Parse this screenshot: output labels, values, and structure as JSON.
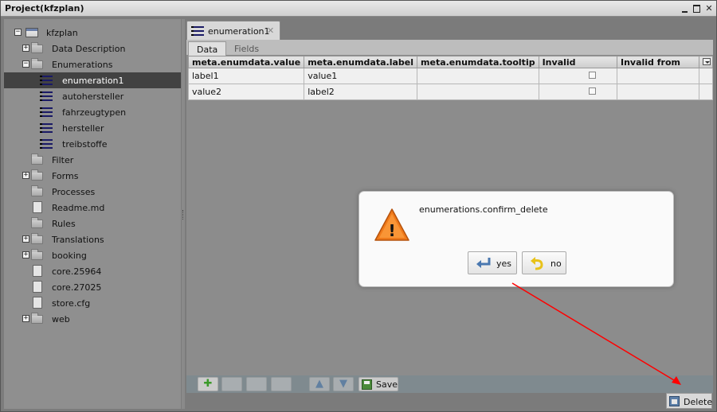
{
  "window": {
    "title": "Project(kfzplan)",
    "minimize_icon": "minimize-icon",
    "maximize_icon": "maximize-icon",
    "close_glyph": "✕"
  },
  "tree": {
    "items": [
      {
        "label": "kfzplan",
        "icon": "project-icon",
        "toggle": "−",
        "level": 0
      },
      {
        "label": "Data Description",
        "icon": "folder-icon",
        "toggle": "+",
        "level": 1
      },
      {
        "label": "Enumerations",
        "icon": "folder-icon",
        "toggle": "−",
        "level": 1
      },
      {
        "label": "enumeration1",
        "icon": "list-icon",
        "toggle": "",
        "level": 2,
        "selected": true
      },
      {
        "label": "autohersteller",
        "icon": "list-icon",
        "toggle": "",
        "level": 2
      },
      {
        "label": "fahrzeugtypen",
        "icon": "list-icon",
        "toggle": "",
        "level": 2
      },
      {
        "label": "hersteller",
        "icon": "list-icon",
        "toggle": "",
        "level": 2
      },
      {
        "label": "treibstoffe",
        "icon": "list-icon",
        "toggle": "",
        "level": 2
      },
      {
        "label": "Filter",
        "icon": "folder-icon",
        "toggle": "",
        "level": 1
      },
      {
        "label": "Forms",
        "icon": "folder-icon",
        "toggle": "+",
        "level": 1
      },
      {
        "label": "Processes",
        "icon": "folder-icon",
        "toggle": "",
        "level": 1
      },
      {
        "label": "Readme.md",
        "icon": "file-icon",
        "toggle": "",
        "level": 1
      },
      {
        "label": "Rules",
        "icon": "folder-icon",
        "toggle": "",
        "level": 1
      },
      {
        "label": "Translations",
        "icon": "folder-icon",
        "toggle": "+",
        "level": 1
      },
      {
        "label": "booking",
        "icon": "folder-icon",
        "toggle": "+",
        "level": 1
      },
      {
        "label": "core.25964",
        "icon": "file-icon",
        "toggle": "",
        "level": 1
      },
      {
        "label": "core.27025",
        "icon": "file-icon",
        "toggle": "",
        "level": 1
      },
      {
        "label": "store.cfg",
        "icon": "file-icon",
        "toggle": "",
        "level": 1
      },
      {
        "label": "web",
        "icon": "folder-icon",
        "toggle": "+",
        "level": 1
      }
    ]
  },
  "editor": {
    "tab": {
      "label": "enumeration1",
      "close_glyph": "✕"
    },
    "sub_tabs": [
      {
        "label": "Data",
        "active": true
      },
      {
        "label": "Fields",
        "active": false
      }
    ],
    "grid": {
      "columns": [
        "meta.enumdata.value",
        "meta.enumdata.label",
        "meta.enumdata.tooltip",
        "Invalid",
        "Invalid from",
        ""
      ],
      "rows": [
        {
          "value": "label1",
          "label": "value1",
          "tooltip": "",
          "invalid": false,
          "invalid_from": ""
        },
        {
          "value": "value2",
          "label": "label2",
          "tooltip": "",
          "invalid": false,
          "invalid_from": ""
        }
      ]
    },
    "toolbar": {
      "add_glyph": "✚",
      "save_label": "Save"
    },
    "status": {
      "delete_label": "Delete"
    }
  },
  "dialog": {
    "message": "enumerations.confirm_delete",
    "yes_label": "yes",
    "no_label": "no",
    "warning_glyph": "!"
  },
  "colors": {
    "annotation_arrow": "#ff0000",
    "warning_orange": "#f07a1a",
    "selected_row": "#424242"
  }
}
